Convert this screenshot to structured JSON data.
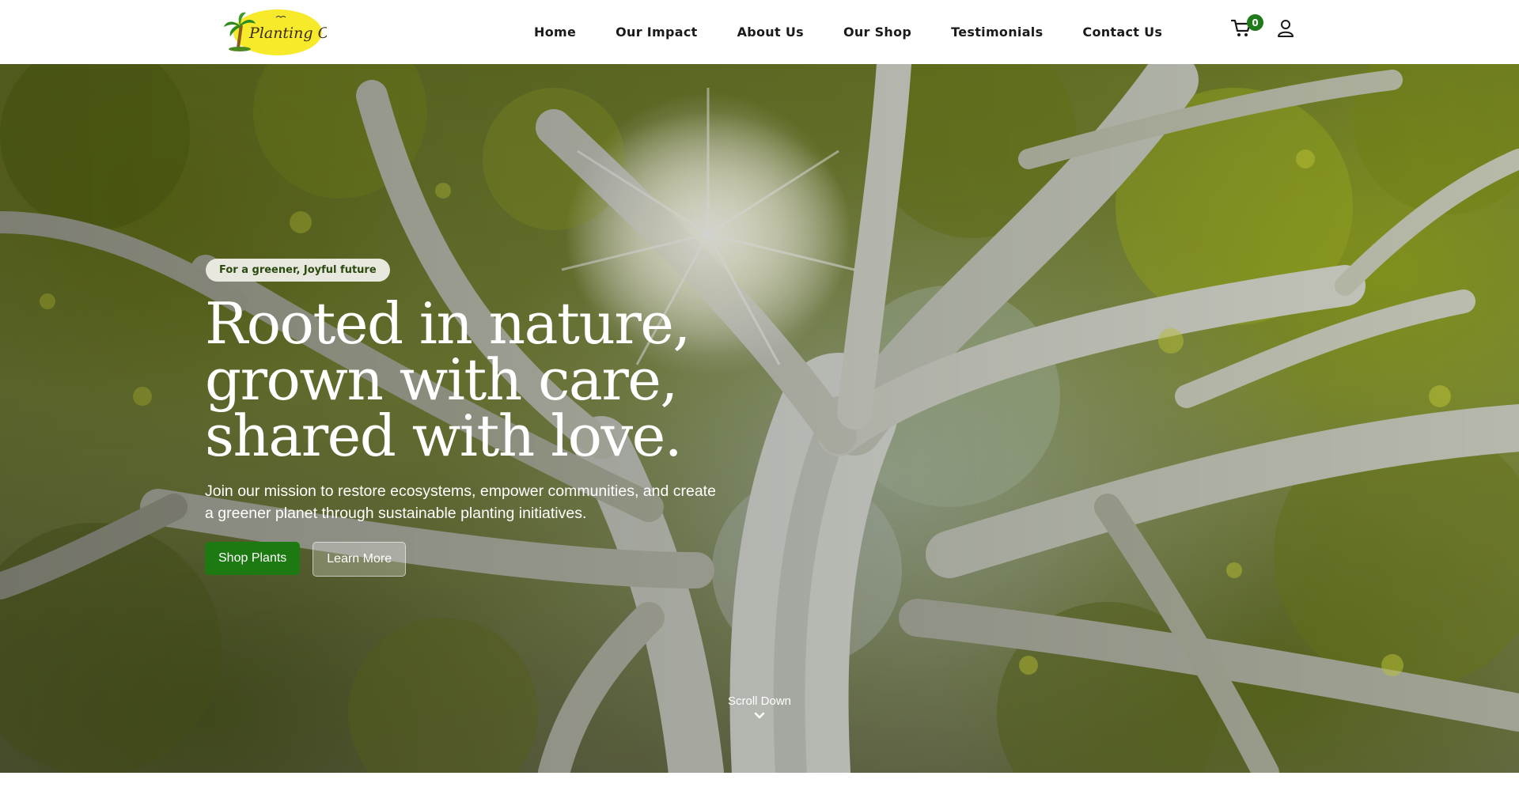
{
  "header": {
    "logo_text": "Planting Co.",
    "nav": [
      {
        "label": "Home"
      },
      {
        "label": "Our Impact"
      },
      {
        "label": "About Us"
      },
      {
        "label": "Our Shop"
      },
      {
        "label": "Testimonials"
      },
      {
        "label": "Contact Us"
      }
    ],
    "cart": {
      "icon": "cart-icon",
      "count": "0"
    },
    "account": {
      "icon": "user-icon"
    }
  },
  "hero": {
    "tag": "For a greener, Joyful future",
    "title": "Rooted in nature,\ngrown with care,\nshared with love.",
    "description": "Join our mission to restore ecosystems, empower communities, and create a greener planet through sustainable planting initiatives.",
    "primary_button": "Shop Plants",
    "secondary_button": "Learn More",
    "scroll_label": "Scroll Down",
    "scroll_icon": "chevron-down-icon"
  },
  "colors": {
    "accent_green": "#1d7a12",
    "badge_green": "#1f7a1a",
    "logo_yellow": "#f7ea2a"
  }
}
